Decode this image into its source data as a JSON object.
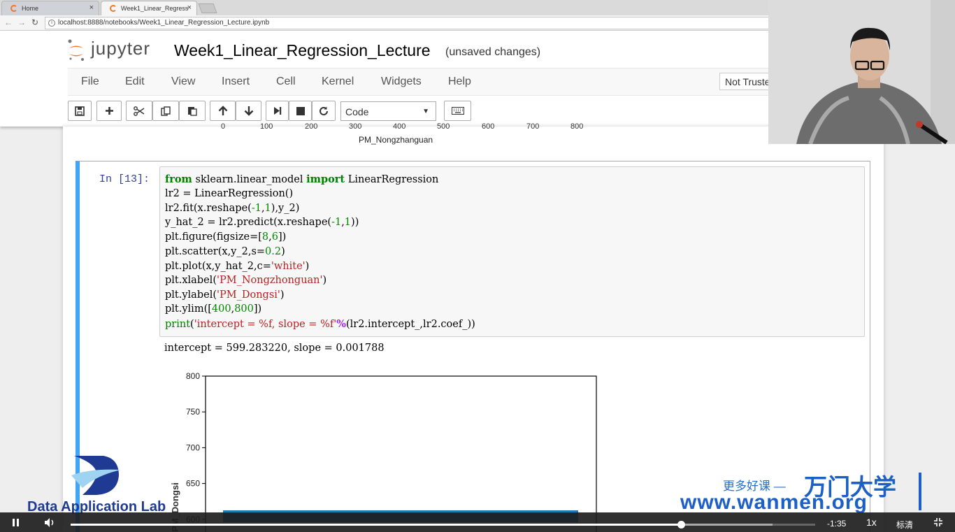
{
  "browser": {
    "tabs": [
      {
        "label": "Home",
        "close": "×"
      },
      {
        "label": "Week1_Linear_Regress",
        "close": "×"
      }
    ],
    "url": "localhost:8888/notebooks/Week1_Linear_Regression_Lecture.ipynb",
    "info_icon": "i"
  },
  "jupyter": {
    "logo_text": "jupyter",
    "notebook_title": "Week1_Linear_Regression_Lecture",
    "status": "(unsaved changes)",
    "menu": [
      "File",
      "Edit",
      "View",
      "Insert",
      "Cell",
      "Kernel",
      "Widgets",
      "Help"
    ],
    "trust_label": "Not Trusted",
    "cell_type": "Code"
  },
  "previous_output": {
    "x_ticks": [
      "0",
      "100",
      "200",
      "300",
      "400",
      "500",
      "600",
      "700",
      "800"
    ],
    "x_label": "PM_Nongzhanguan"
  },
  "cell": {
    "prompt": "In  [13]:",
    "output": "intercept = 599.283220, slope = 0.001788"
  },
  "chart_data": {
    "type": "scatter",
    "xlabel": "",
    "ylabel": "PM_Dongsi",
    "ylim": [
      400,
      800
    ],
    "y_ticks": [
      "800",
      "750",
      "700",
      "650",
      "600"
    ],
    "visible_y_values": [
      800,
      750,
      700,
      650,
      600
    ],
    "fit_line": {
      "intercept": 599.28322,
      "slope": 0.001788
    },
    "point_color": "#1f77b4"
  },
  "watermarks": {
    "lab_name": "Data Application Lab",
    "cn_slogan": "更多好课 —",
    "brand": "万门大学",
    "site": "www.wanmen.org"
  },
  "video": {
    "time_remaining": "-1:35",
    "speed": "1x",
    "quality": "标清",
    "progress": 0.82,
    "buffered": 0.943
  }
}
